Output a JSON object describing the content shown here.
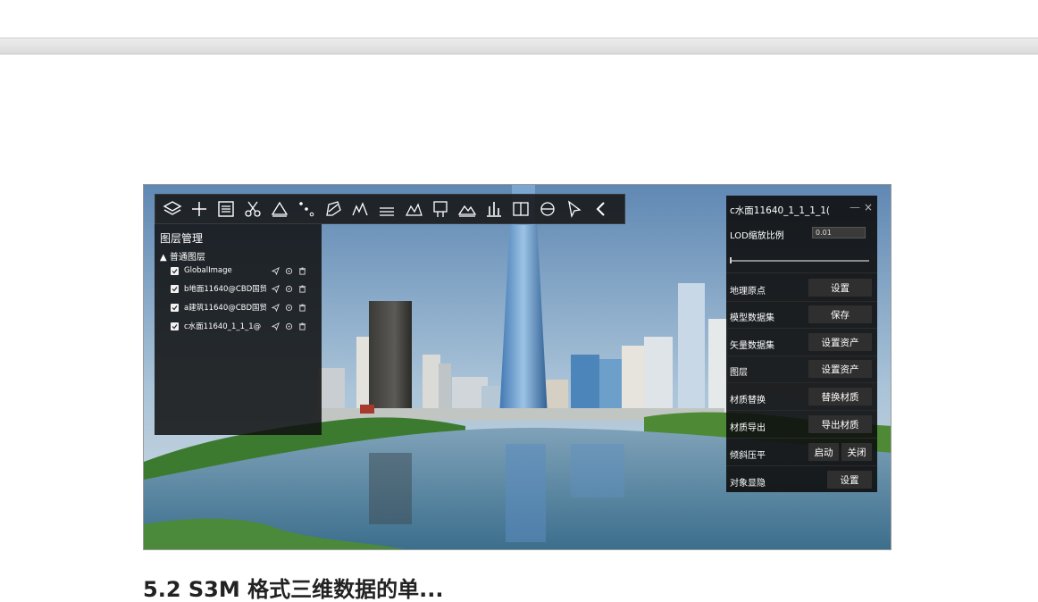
{
  "toolbar": {
    "icons": [
      "layers-icon",
      "plus-icon",
      "list-icon",
      "scissors-icon",
      "measure-area-icon",
      "points-icon",
      "draw-polygon-icon",
      "terrain-profile-icon",
      "ruler-icon",
      "volume-icon",
      "flag-icon",
      "mountain-icon",
      "height-icon",
      "split-icon",
      "dome-icon",
      "pointer-icon",
      "collapse-icon"
    ]
  },
  "layer_panel": {
    "title": "图层管理",
    "group_label": "普通图层",
    "layers": [
      {
        "name": "GlobalImage",
        "checked": true
      },
      {
        "name": "b地面11640@CBD国贸",
        "checked": true
      },
      {
        "name": "a建筑11640@CBD国贸",
        "checked": true
      },
      {
        "name": "c水面11640_1_1_1@",
        "checked": true
      }
    ]
  },
  "property_panel": {
    "title": "c水面11640_1_1_1_1(",
    "minimize": "—",
    "close": "×",
    "lod_label": "LOD缩放比例",
    "lod_value": "0.01",
    "rows": [
      {
        "label": "地理原点",
        "buttons": [
          "设置"
        ]
      },
      {
        "label": "模型数据集",
        "buttons": [
          "保存"
        ]
      },
      {
        "label": "矢量数据集",
        "buttons": [
          "设置资产"
        ]
      },
      {
        "label": "图层",
        "buttons": [
          "设置资产"
        ]
      },
      {
        "label": "材质替换",
        "buttons": [
          "替换材质"
        ]
      },
      {
        "label": "材质导出",
        "buttons": [
          "导出材质"
        ]
      },
      {
        "label": "倾斜压平",
        "buttons": [
          "启动",
          "关闭"
        ]
      },
      {
        "label": "对象显隐",
        "buttons": [
          "设置"
        ]
      }
    ]
  },
  "heading": "5.2 S3M 格式三维数据的单..."
}
